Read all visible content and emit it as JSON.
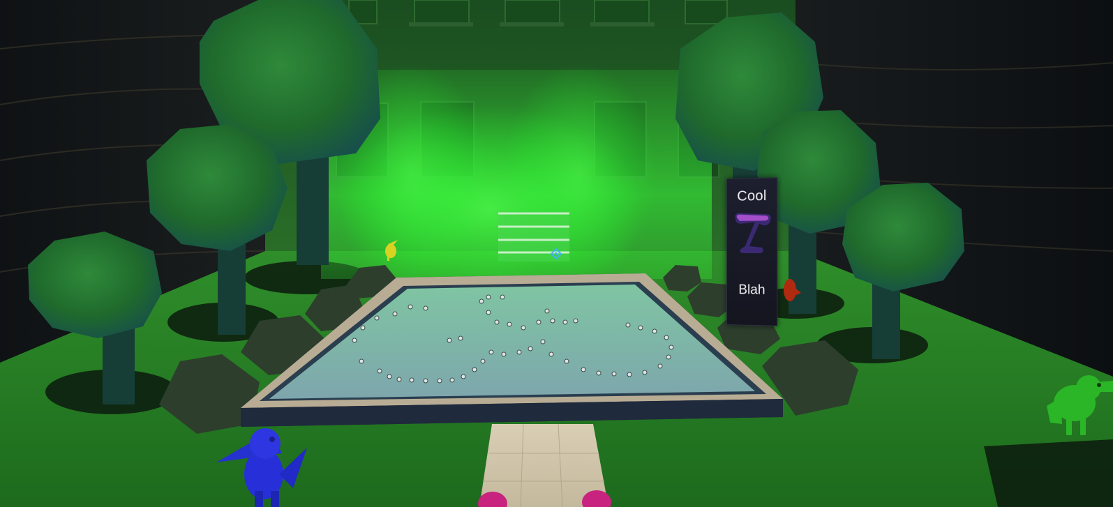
{
  "sign": {
    "top_label": "Cool",
    "bottom_label": "Blah"
  },
  "icons": {
    "sign_icon": "purple-hammer-icon",
    "crosshair": "crosshair-reticle-icon"
  },
  "colors": {
    "grass": "#2c8a28",
    "fog": "#39ff3a",
    "pool_water": "#8fb3b1",
    "stone_rim": "#b9ae96",
    "sign_panel": "#181a26",
    "sign_icon": "#8b3fb4",
    "crosshair": "#3fb1ff",
    "player_blue": "#2730d8",
    "player_green": "#2ab627",
    "player_yellow": "#d8d322",
    "player_red": "#b02a10",
    "hands_pink": "#c8237e"
  }
}
